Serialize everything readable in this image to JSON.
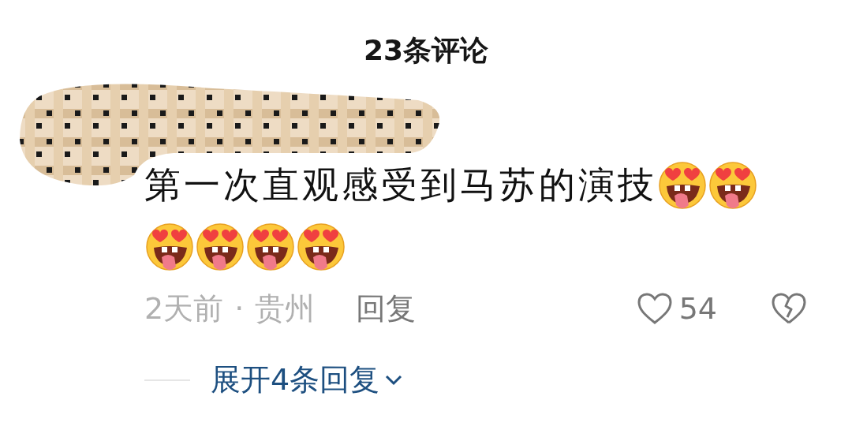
{
  "title": "23条评论",
  "comment": {
    "text": "第一次直观感受到马苏的演技",
    "time": "2天前",
    "separator": "·",
    "location": "贵州",
    "reply": "回复",
    "likes": "54",
    "liked": false
  },
  "expand_replies": "展开4条回复"
}
